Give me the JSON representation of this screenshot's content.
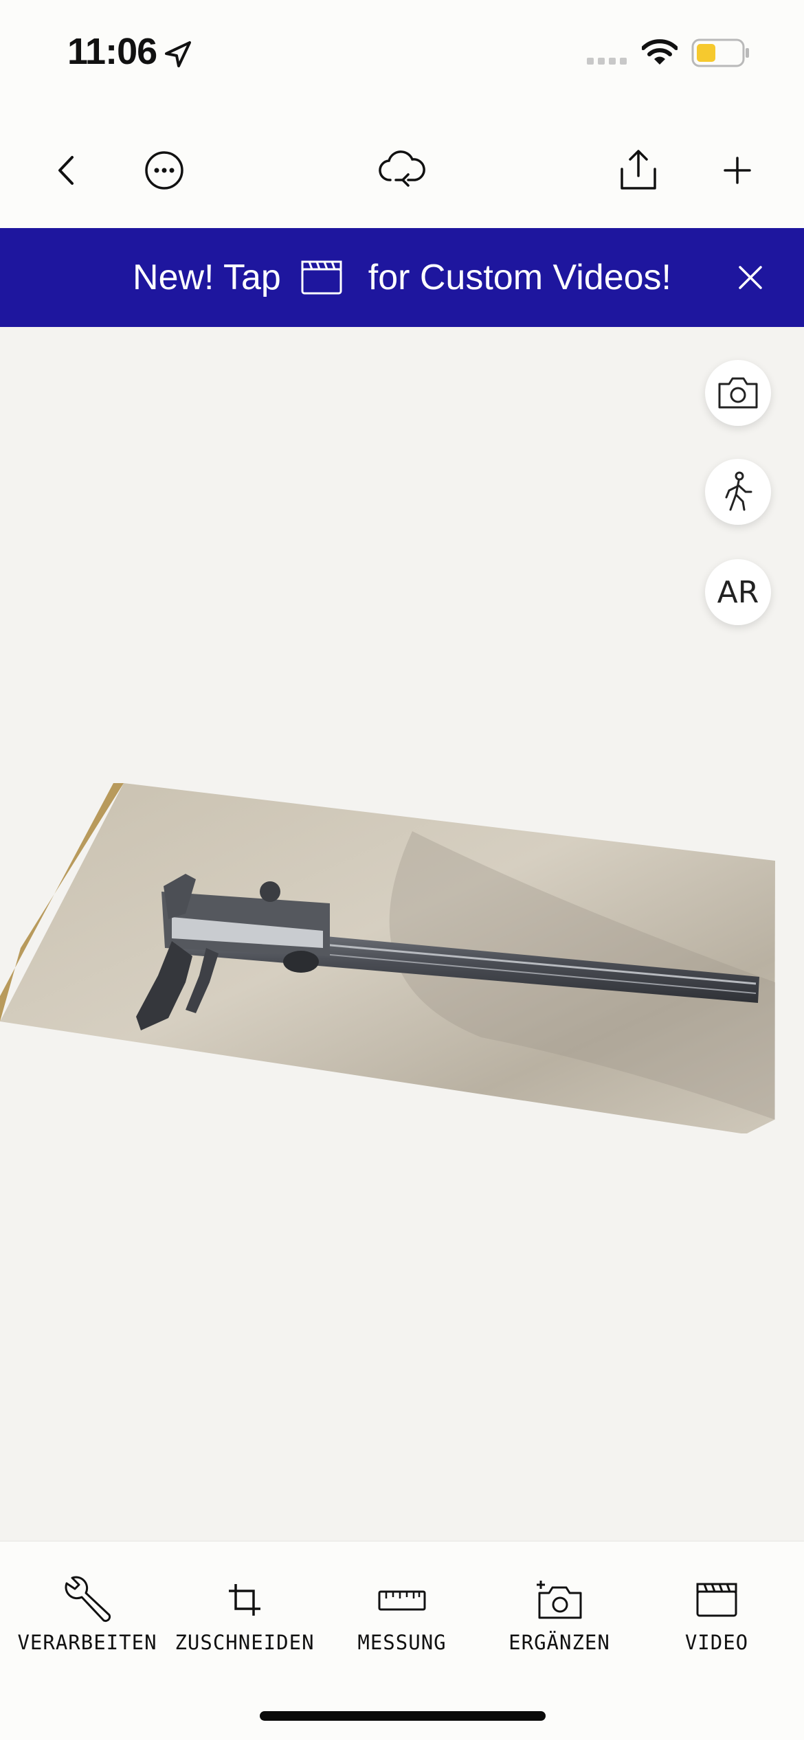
{
  "status": {
    "time": "11:06"
  },
  "banner": {
    "text_before": "New! Tap ",
    "text_after": " for Custom Videos!",
    "icon": "clapperboard-icon",
    "color": "#1e169e"
  },
  "nav": {
    "icons": [
      "back-icon",
      "more-icon",
      "cloud-sync-icon",
      "share-icon",
      "add-icon"
    ]
  },
  "side_buttons": {
    "ar_label": "AR"
  },
  "toolbar": {
    "items": [
      {
        "label": "VERARBEITEN",
        "icon": "wrench-icon"
      },
      {
        "label": "ZUSCHNEIDEN",
        "icon": "crop-icon"
      },
      {
        "label": "MESSUNG",
        "icon": "ruler-icon"
      },
      {
        "label": "ERGÄNZEN",
        "icon": "add-photo-icon"
      },
      {
        "label": "VIDEO",
        "icon": "clapperboard-icon"
      }
    ]
  },
  "accent": "#1e169e"
}
